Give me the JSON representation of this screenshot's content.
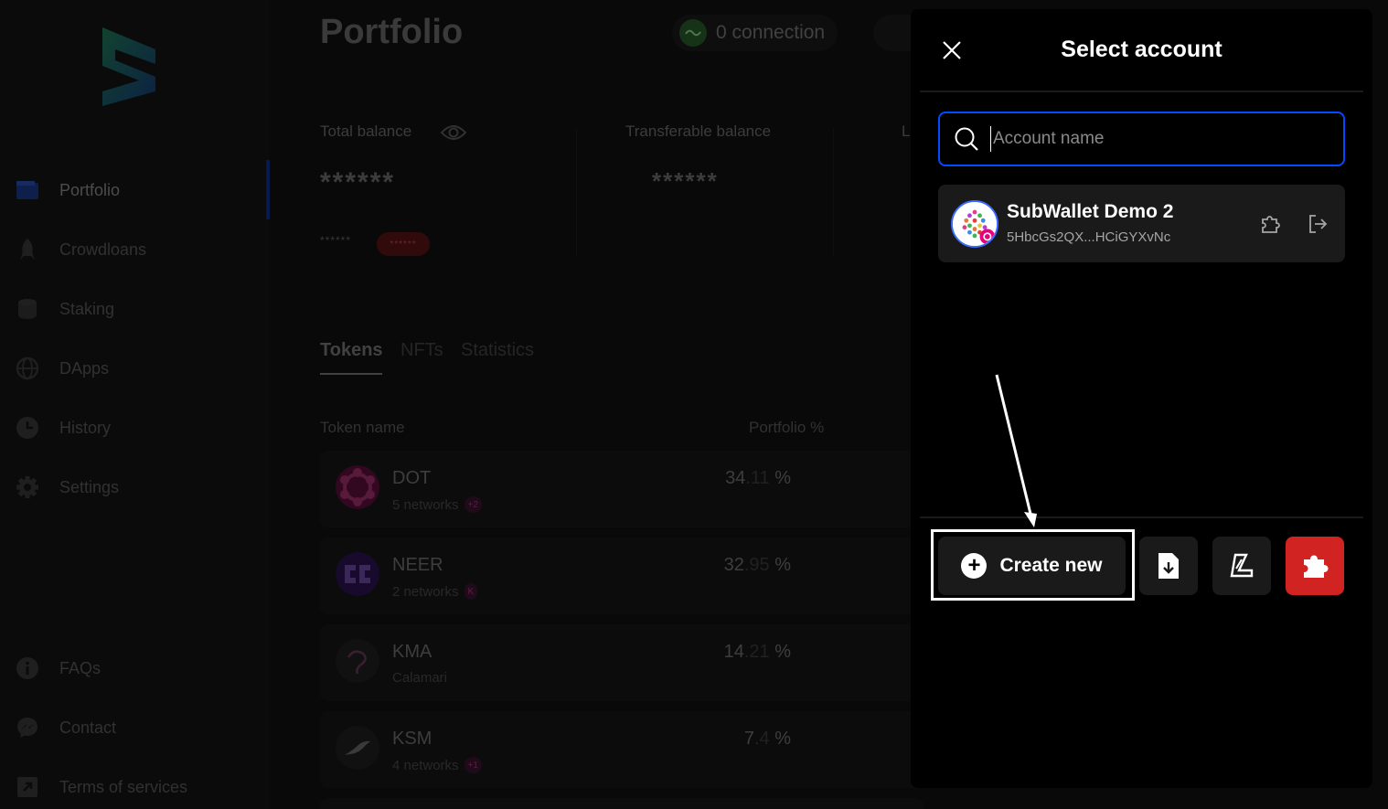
{
  "sidebar": {
    "logo": "subwallet-logo",
    "items": [
      {
        "label": "Portfolio",
        "icon": "wallet-icon"
      },
      {
        "label": "Crowdloans",
        "icon": "rocket-icon"
      },
      {
        "label": "Staking",
        "icon": "database-icon"
      },
      {
        "label": "DApps",
        "icon": "globe-icon"
      },
      {
        "label": "History",
        "icon": "clock-icon"
      },
      {
        "label": "Settings",
        "icon": "gear-icon"
      }
    ],
    "footer_items": [
      {
        "label": "FAQs",
        "icon": "info-icon"
      },
      {
        "label": "Contact",
        "icon": "messenger-icon"
      },
      {
        "label": "Terms of services",
        "icon": "external-link-icon"
      }
    ]
  },
  "header": {
    "title": "Portfolio",
    "connection_label": "0 connection"
  },
  "balances": {
    "total_label": "Total balance",
    "total_value": "******",
    "total_sub_value": "******",
    "total_change": "******",
    "transferable_label": "Transferable balance",
    "transferable_value": "******",
    "third_label_partial": "L"
  },
  "tabs": [
    {
      "label": "Tokens",
      "active": true
    },
    {
      "label": "NFTs",
      "active": false
    },
    {
      "label": "Statistics",
      "active": false
    }
  ],
  "table": {
    "headers": {
      "token_name": "Token name",
      "portfolio": "Portfolio %"
    },
    "rows": [
      {
        "symbol": "DOT",
        "networks": "5 networks",
        "chip": "+2",
        "pct_int": "34",
        "pct_dec": ".11",
        "pct_sign": "%",
        "logo_color": "#e6007a"
      },
      {
        "symbol": "NEER",
        "networks": "2 networks",
        "chip": "K",
        "pct_int": "32",
        "pct_dec": ".95",
        "pct_sign": "%",
        "logo_color": "#6a2bbf"
      },
      {
        "symbol": "KMA",
        "networks": "Calamari",
        "chip": "",
        "pct_int": "14",
        "pct_dec": ".21",
        "pct_sign": "%",
        "logo_color": "#2a2a2a"
      },
      {
        "symbol": "KSM",
        "networks": "4 networks",
        "chip": "+1",
        "pct_int": "7",
        "pct_dec": ".4",
        "pct_sign": "%",
        "logo_color": "#2a2a2a"
      }
    ]
  },
  "modal": {
    "title": "Select account",
    "search_placeholder": "Account name",
    "account": {
      "name": "SubWallet Demo 2",
      "address": "5HbcGs2QX...HCiGYXvNc"
    },
    "create_label": "Create new",
    "buttons": [
      "import-icon",
      "ledger-icon",
      "extension-icon"
    ],
    "accent_color": "#004bff",
    "danger_color": "#d22323"
  }
}
